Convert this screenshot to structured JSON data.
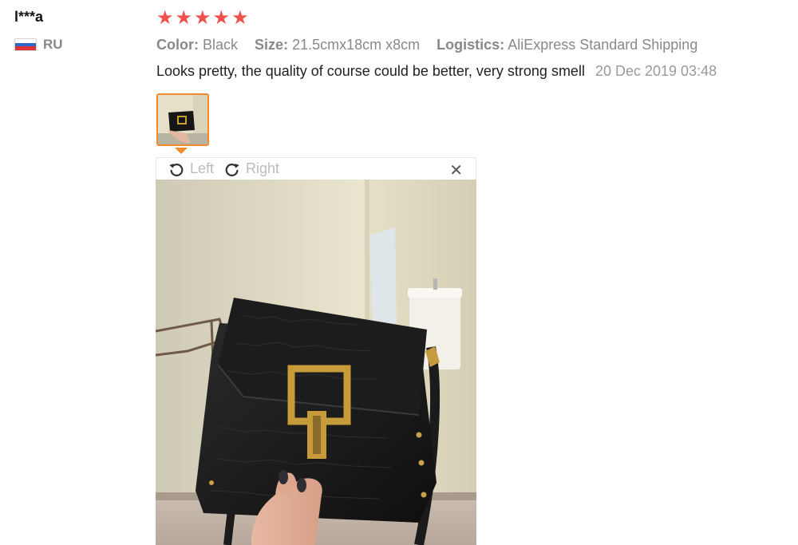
{
  "reviewer": {
    "name": "l***a",
    "country_code": "RU",
    "flag_colors": [
      "#ffffff",
      "#2f66c3",
      "#e0303a"
    ]
  },
  "rating": {
    "stars": 5,
    "star_color": "#f0524b",
    "star_glyph": "★"
  },
  "attributes": [
    {
      "label": "Color:",
      "value": "Black"
    },
    {
      "label": "Size:",
      "value": "21.5cmx18cm x8cm"
    },
    {
      "label": "Logistics:",
      "value": "AliExpress Standard Shipping"
    }
  ],
  "review": {
    "text": "Looks pretty, the quality of course could be better, very strong smell",
    "date": "20 Dec 2019 03:48"
  },
  "viewer": {
    "rotate_left_label": "Left",
    "rotate_right_label": "Right",
    "close_glyph": "✕",
    "accent_color": "#f28a2e"
  }
}
